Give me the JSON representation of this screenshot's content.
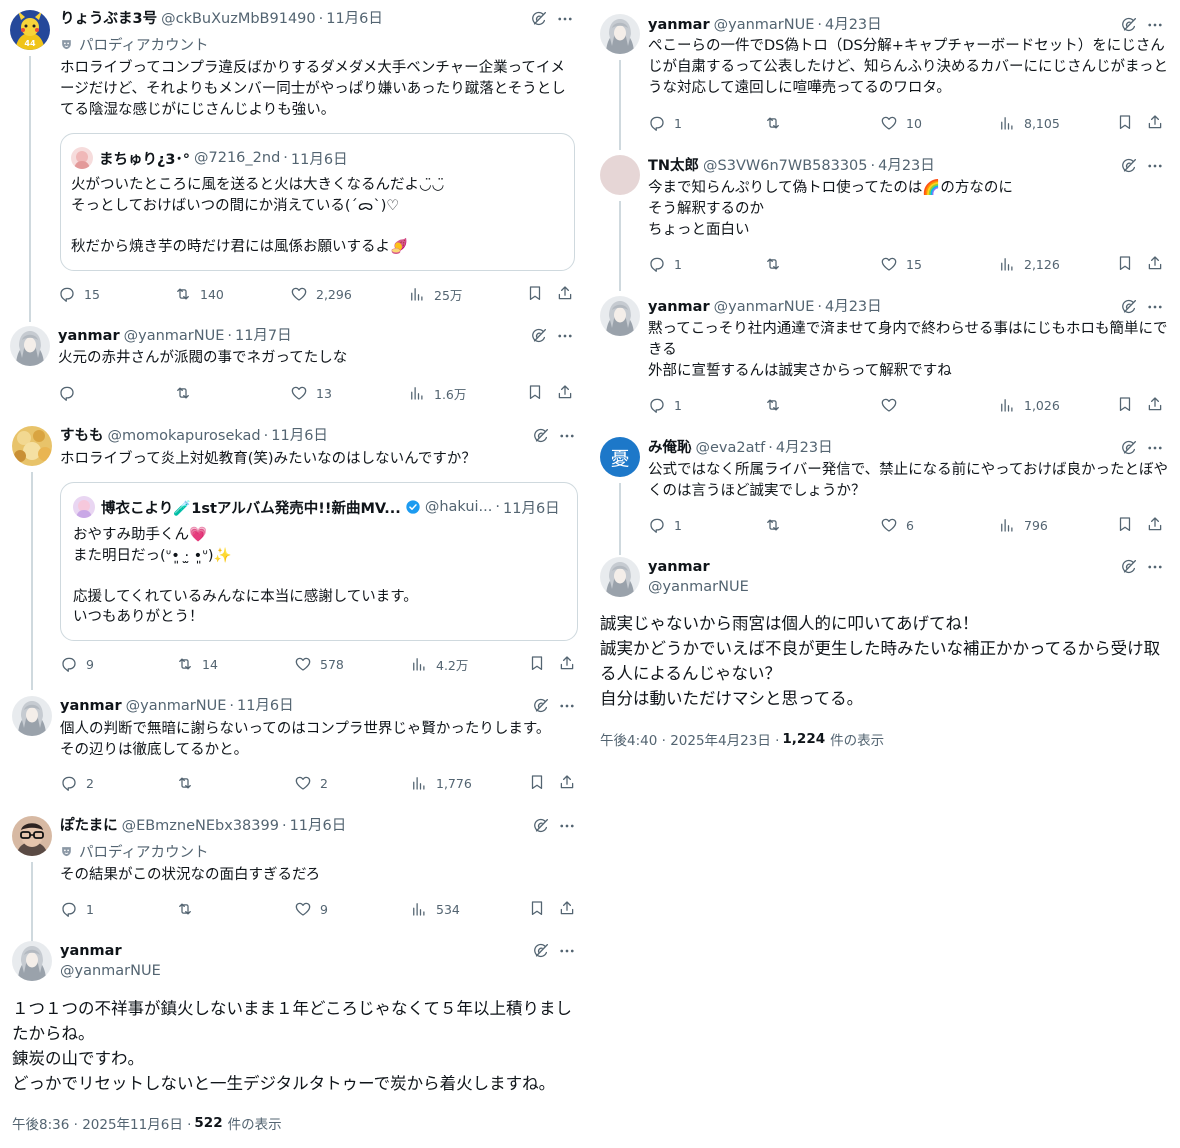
{
  "common": {
    "parody_label": "パロディアカウント",
    "dot": "·",
    "views_suffix": "件の表示"
  },
  "left": {
    "p1": {
      "name": "りょうぶま3号",
      "handle": "@ckBuXuzMbB91490",
      "date": "11月6日",
      "text": "ホロライブってコンプラ違反ばかりするダメダメ大手ベンチャー企業ってイメージだけど、それよりもメンバー同士がやっぱり嫌いあったり蹴落とそうとしてる陰湿な感じがにじさんじよりも強い。",
      "quote": {
        "name": "まちゅり¿3･°",
        "handle": "@7216_2nd",
        "date": "11月6日",
        "text": "火がついたところに風を送ると火は大きくなるんだよ◡̈◡̈\nそっとしておけばいつの間にか消えている(ˊᯅˋ)♡\n\n秋だから焼き芋の時だけ君には風係お願いするよ🍠"
      },
      "replies": "15",
      "reposts": "140",
      "likes": "2,296",
      "views": "25万"
    },
    "p2": {
      "name": "yanmar",
      "handle": "@yanmarNUE",
      "date": "11月7日",
      "text": "火元の赤井さんが派閥の事でネガってたしな",
      "replies": "",
      "reposts": "",
      "likes": "13",
      "views": "1.6万"
    },
    "p3": {
      "name": "すもも",
      "handle": "@momokapurosekad",
      "date": "11月6日",
      "text": "ホロライブって炎上対処教育(笑)みたいなのはしないんですか？",
      "quote": {
        "name": "博衣こより🧪1stアルバム発売中!!新曲MV...",
        "handle": "@hakui...",
        "date": "11月6日",
        "text": "おやすみ助手くん💗\nまた明日だっ(ᐡ•͈ ·̫ •͈ᐡ)✨\n\n応援してくれているみんなに本当に感謝しています。\nいつもありがとう！"
      },
      "replies": "9",
      "reposts": "14",
      "likes": "578",
      "views": "4.2万"
    },
    "p4": {
      "name": "yanmar",
      "handle": "@yanmarNUE",
      "date": "11月6日",
      "text": "個人の判断で無暗に謝らないってのはコンプラ世界じゃ賢かったりします。\nその辺りは徹底してるかと。",
      "replies": "2",
      "reposts": "",
      "likes": "2",
      "views": "1,776"
    },
    "p5": {
      "name": "ぽたまに",
      "handle": "@EBmzneNEbx38399",
      "date": "11月6日",
      "text": "その結果がこの状況なの面白すぎるだろ",
      "replies": "1",
      "reposts": "",
      "likes": "9",
      "views": "534"
    },
    "main": {
      "name": "yanmar",
      "handle": "@yanmarNUE",
      "text": "１つ１つの不祥事が鎮火しないまま１年どころじゃなくて５年以上積りましたからね。\n錬炭の山ですわ。\nどっかでリセットしないと一生デジタルタトゥーで炭から着火しますね。",
      "timestamp": "午後8:36 · 2025年11月6日 · ",
      "views": "522"
    }
  },
  "right": {
    "p1": {
      "name": "yanmar",
      "handle": "@yanmarNUE",
      "date": "4月23日",
      "text": "ぺこーらの一件でDS偽トロ（DS分解+キャプチャーボードセット）をにじさんじが自粛するって公表したけど、知らんふり決めるカバーににじさんじがまっとうな対応して遠回しに喧嘩売ってるのワロタ。",
      "replies": "1",
      "reposts": "",
      "likes": "10",
      "views": "8,105"
    },
    "p2": {
      "name": "TN太郎",
      "handle": "@S3VW6n7WB583305",
      "date": "4月23日",
      "text": "今まで知らんぷりして偽トロ使ってたのは🌈の方なのに\nそう解釈するのか\nちょっと面白い",
      "replies": "1",
      "reposts": "",
      "likes": "15",
      "views": "2,126"
    },
    "p3": {
      "name": "yanmar",
      "handle": "@yanmarNUE",
      "date": "4月23日",
      "text": "黙ってこっそり社内通達で済ませて身内で終わらせる事はにじもホロも簡単にできる\n外部に宣誓するんは誠実さからって解釈ですね",
      "replies": "1",
      "reposts": "",
      "likes": "",
      "views": "1,026"
    },
    "p4": {
      "name": "み俺恥",
      "handle": "@eva2atf",
      "date": "4月23日",
      "avatar_char": "憂",
      "text": "公式ではなく所属ライバー発信で、禁止になる前にやっておけば良かったとぼやくのは言うほど誠実でしょうか？",
      "replies": "1",
      "reposts": "",
      "likes": "6",
      "views": "796"
    },
    "main": {
      "name": "yanmar",
      "handle": "@yanmarNUE",
      "text": "誠実じゃないから雨宮は個人的に叩いてあげてね！\n誠実かどうかでいえば不良が更生した時みたいな補正かかってるから受け取る人によるんじゃない？\n自分は動いただけマシと思ってる。",
      "timestamp": "午後4:40 · 2025年4月23日 · ",
      "views": "1,224"
    }
  },
  "colors": {
    "text": "#0f1419",
    "secondary": "#536471",
    "border": "#cfd9de",
    "blue_avatar": "#1d78c9"
  }
}
